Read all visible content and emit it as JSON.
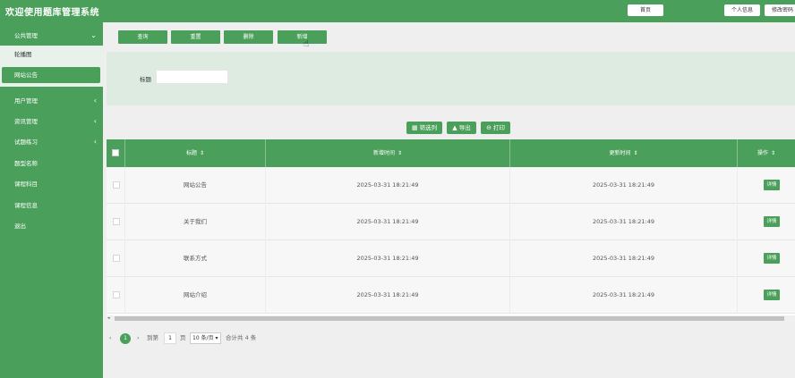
{
  "header": {
    "title": "欢迎使用题库管理系统",
    "home_label": "首页",
    "profile_label": "个人信息",
    "password_label": "修改密码"
  },
  "sidebar": {
    "groups": [
      {
        "label": "公共管理",
        "expanded": true,
        "children": [
          {
            "label": "轮播图"
          },
          {
            "label": "网站公告",
            "active": true
          }
        ]
      },
      {
        "label": "用户管理",
        "has_arrow": true
      },
      {
        "label": "资讯管理",
        "has_arrow": true
      },
      {
        "label": "试题练习",
        "has_arrow": true
      },
      {
        "label": "题型名称"
      },
      {
        "label": "课程科目"
      },
      {
        "label": "课程信息"
      },
      {
        "label": "退出"
      }
    ]
  },
  "toolbar": {
    "query_label": "查询",
    "reset_label": "重置",
    "delete_label": "删除",
    "add_label": "新增"
  },
  "search": {
    "label": "标题",
    "value": "",
    "placeholder": ""
  },
  "actions": {
    "filter_columns_label": "筛选列",
    "export_label": "导出",
    "print_label": "打印"
  },
  "table": {
    "columns": [
      "标题",
      "新增时间",
      "更新时间",
      "操作"
    ],
    "rows": [
      {
        "title": "网站公告",
        "created": "2025-03-31 18:21:49",
        "updated": "2025-03-31 18:21:49",
        "action": "详情"
      },
      {
        "title": "关于我们",
        "created": "2025-03-31 18:21:49",
        "updated": "2025-03-31 18:21:49",
        "action": "详情"
      },
      {
        "title": "联系方式",
        "created": "2025-03-31 18:21:49",
        "updated": "2025-03-31 18:21:49",
        "action": "详情"
      },
      {
        "title": "网站介绍",
        "created": "2025-03-31 18:21:49",
        "updated": "2025-03-31 18:21:49",
        "action": "详情"
      }
    ]
  },
  "pagination": {
    "prev": "‹",
    "current": "1",
    "next": "›",
    "goto_label": "到第",
    "goto_value": "1",
    "page_unit": "页",
    "page_size": "10 条/页",
    "total": "合计共 4 条"
  },
  "colors": {
    "primary": "#4a9f5a",
    "search_panel": "#ddebe1",
    "background": "#efefef"
  }
}
